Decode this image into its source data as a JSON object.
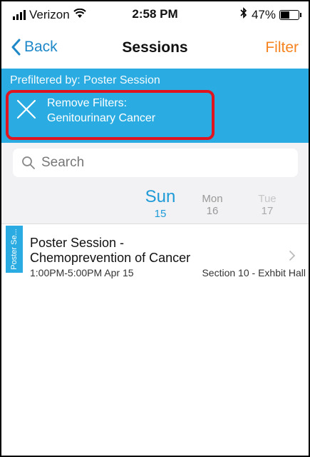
{
  "status_bar": {
    "carrier": "Verizon",
    "time": "2:58 PM",
    "battery": "47%",
    "battery_level": 0.47
  },
  "nav": {
    "back_label": "Back",
    "title": "Sessions",
    "filter_label": "Filter"
  },
  "filters": {
    "prefiltered_text": "Prefiltered by: Poster Session",
    "remove_label": "Remove Filters:",
    "remove_value": "Genitourinary Cancer"
  },
  "search": {
    "placeholder": "Search"
  },
  "days": [
    {
      "name": "Sun",
      "num": "15",
      "selected": true
    },
    {
      "name": "Mon",
      "num": "16",
      "selected": false
    },
    {
      "name": "Tue",
      "num": "17",
      "selected": false
    }
  ],
  "sessions": [
    {
      "tag": "Poster Se...",
      "title_line1": "Poster Session -",
      "title_line2": "Chemoprevention of Cancer",
      "time": "1:00PM-5:00PM  Apr 15",
      "location": "Section 10 - Exhbit Hall"
    }
  ],
  "colors": {
    "accent_blue": "#2aace2",
    "link_blue": "#1e88c8",
    "filter_orange": "#f5841f",
    "highlight_red": "#e0141e"
  },
  "icons": [
    "signal-icon",
    "wifi-icon",
    "bluetooth-icon",
    "battery-icon",
    "chevron-left-icon",
    "close-icon",
    "search-icon",
    "chevron-right-icon"
  ]
}
